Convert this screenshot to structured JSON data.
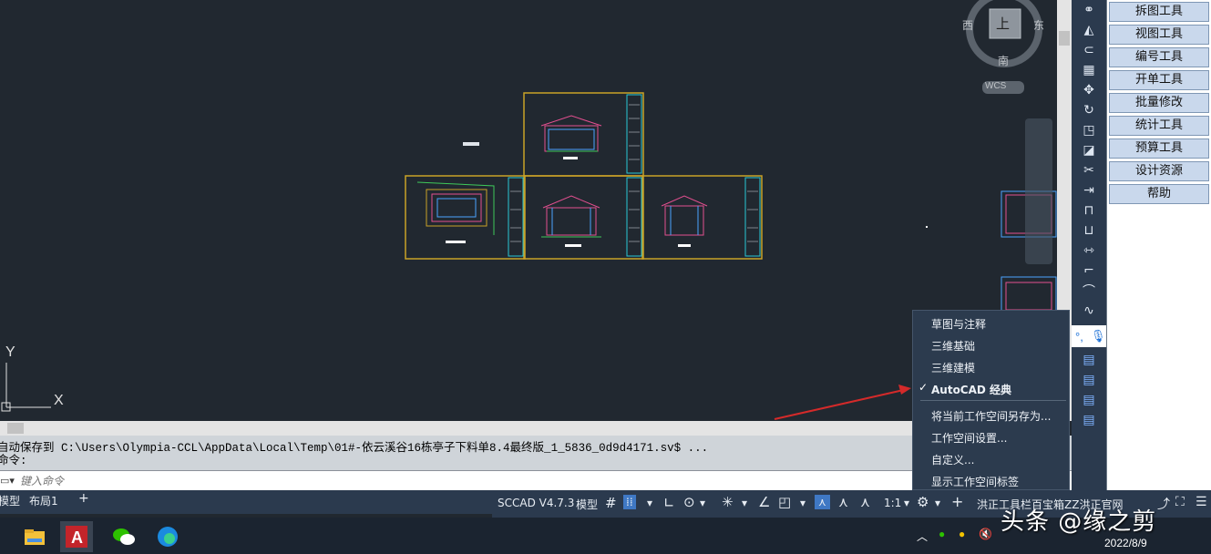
{
  "compass": {
    "north": "上",
    "west": "西",
    "east": "东",
    "south": "南",
    "wcs": "WCS"
  },
  "ucs": {
    "x": "X",
    "y": "Y"
  },
  "right_panel": {
    "buttons": [
      "拆图工具",
      "视图工具",
      "编号工具",
      "开单工具",
      "批量修改",
      "统计工具",
      "预算工具",
      "设计资源",
      "帮助"
    ]
  },
  "command": {
    "history_line1": "自动保存到 C:\\Users\\Olympia-CCL\\AppData\\Local\\Temp\\01#-依云溪谷16栋亭子下料单8.4最终版_1_5836_0d9d4171.sv$ ...",
    "history_line2": "命令:",
    "placeholder": "键入命令"
  },
  "layout_tabs": {
    "model": "模型",
    "layout1": "布局1",
    "add": "+"
  },
  "status_bar": {
    "version": "SCCAD V4.7.3",
    "model": "模型",
    "scale": "1:1",
    "workspace_text": "洪正工具栏百宝箱ZZ洪正官网"
  },
  "workspace_menu": {
    "items": [
      "草图与注释",
      "三维基础",
      "三维建模",
      "AutoCAD 经典"
    ],
    "checked_index": 3,
    "actions": [
      "将当前工作空间另存为...",
      "工作空间设置...",
      "自定义...",
      "显示工作空间标签"
    ]
  },
  "taskbar": {
    "date": "2022/8/9"
  },
  "watermark": "头条 @缘之剪",
  "colors": {
    "canvas": "#212830",
    "panel": "#2b3a4e",
    "accent": "#3f78c4",
    "drawing_frame": "#c9a227",
    "arrow": "#d42a2a"
  }
}
